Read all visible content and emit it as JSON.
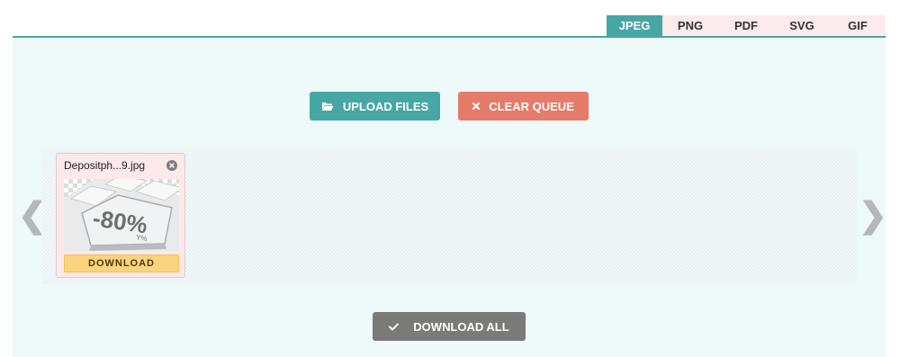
{
  "tabs": {
    "items": [
      {
        "label": "JPEG",
        "active": true
      },
      {
        "label": "PNG",
        "active": false
      },
      {
        "label": "PDF",
        "active": false
      },
      {
        "label": "SVG",
        "active": false
      },
      {
        "label": "GIF",
        "active": false
      }
    ]
  },
  "toolbar": {
    "upload_label": "UPLOAD FILES",
    "upload_icon": "folder-open-icon",
    "clear_label": "CLEAR QUEUE",
    "clear_icon": "x-icon"
  },
  "queue": {
    "prev_arrow": "❮",
    "next_arrow": "❯",
    "files": [
      {
        "name": "Depositph...9.jpg",
        "thumbnail_text": "-80%",
        "thumbnail_subtext": "Y%",
        "download_label": "DOWNLOAD"
      }
    ]
  },
  "footer": {
    "download_all_label": "DOWNLOAD ALL",
    "download_all_icon": "checkmark-icon"
  },
  "colors": {
    "accent": "#47a7a4",
    "clear": "#e57b6a",
    "download_all": "#7a7a78",
    "panel": "#eef9f9",
    "tab_inactive": "#fdeaea",
    "download_button": "#fbd47d"
  }
}
